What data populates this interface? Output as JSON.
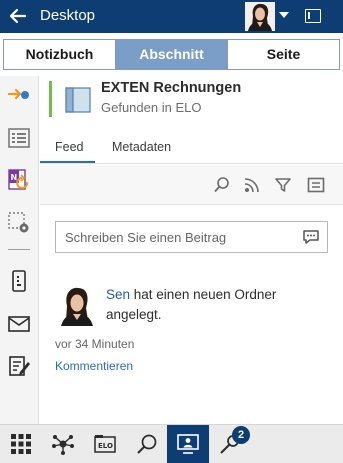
{
  "topbar": {
    "title": "Desktop",
    "colors": {
      "background": "#0d3d73"
    }
  },
  "segments": [
    {
      "label": "Notizbuch",
      "active": false
    },
    {
      "label": "Abschnitt",
      "active": true
    },
    {
      "label": "Seite",
      "active": false
    }
  ],
  "rail": {
    "icons": [
      "arrow-dot-icon",
      "list-icon",
      "onenote-refresh-icon",
      "selection-settings-icon",
      "phone-icon",
      "mail-icon",
      "edit-document-icon"
    ]
  },
  "header": {
    "name": "EXTEN Rechnungen",
    "subtitle": "Gefunden in ELO"
  },
  "tabs": [
    {
      "label": "Feed",
      "active": true
    },
    {
      "label": "Metadaten",
      "active": false
    }
  ],
  "toolbar": {
    "icons": [
      "search-icon",
      "rss-icon",
      "filter-icon",
      "menu-icon"
    ]
  },
  "composer": {
    "placeholder": "Schreiben Sie einen Beitrag"
  },
  "post": {
    "user": "Sen",
    "text": " hat einen neuen Ordner angelegt.",
    "time": "vor 34 Minuten",
    "comment_link": "Kommentieren"
  },
  "bottombar": {
    "icons": [
      "apps-grid-icon",
      "network-icon",
      "elo-archive-icon",
      "search-icon",
      "desktop-user-icon",
      "pin-icon"
    ],
    "active": "desktop-user-icon",
    "badge": "2"
  },
  "colors": {
    "accent": "#2a6eb5",
    "segment_active": "#7b9ec8",
    "status_bar": "#6fbf4a"
  }
}
